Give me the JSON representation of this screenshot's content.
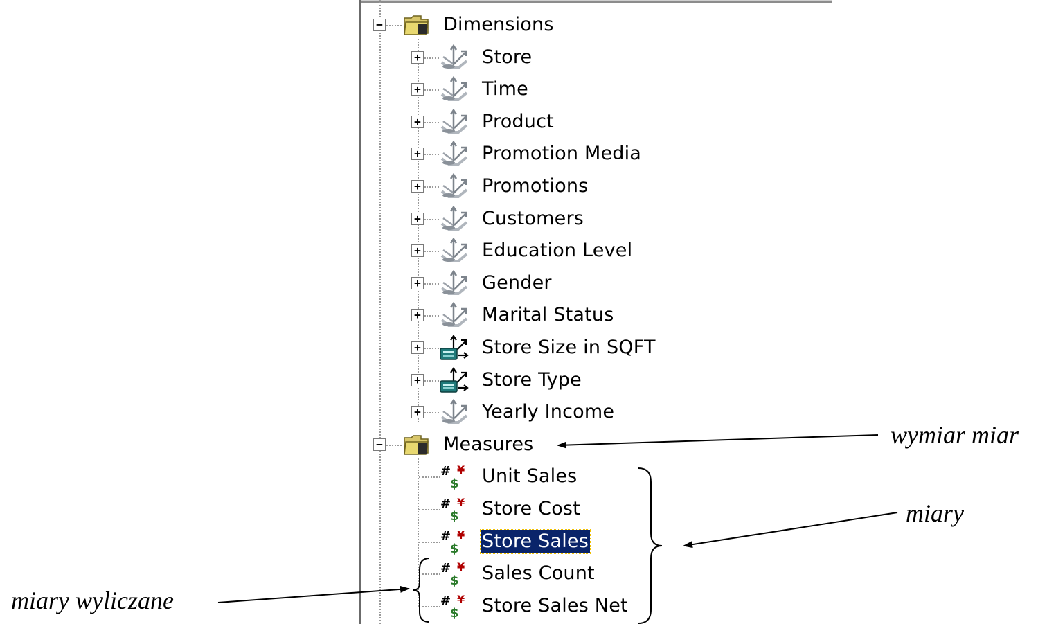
{
  "tree": {
    "dimensions_folder": {
      "label": "Dimensions",
      "expander": "−",
      "icon": "folder-open-icon",
      "items": [
        {
          "label": "Store",
          "expander": "+",
          "icon": "dimension-icon"
        },
        {
          "label": "Time",
          "expander": "+",
          "icon": "dimension-icon"
        },
        {
          "label": "Product",
          "expander": "+",
          "icon": "dimension-icon"
        },
        {
          "label": "Promotion Media",
          "expander": "+",
          "icon": "dimension-icon"
        },
        {
          "label": "Promotions",
          "expander": "+",
          "icon": "dimension-icon"
        },
        {
          "label": "Customers",
          "expander": "+",
          "icon": "dimension-icon"
        },
        {
          "label": "Education Level",
          "expander": "+",
          "icon": "dimension-icon"
        },
        {
          "label": "Gender",
          "expander": "+",
          "icon": "dimension-icon"
        },
        {
          "label": "Marital Status",
          "expander": "+",
          "icon": "dimension-icon"
        },
        {
          "label": "Store Size in SQFT",
          "expander": "+",
          "icon": "virtual-dimension-icon"
        },
        {
          "label": "Store Type",
          "expander": "+",
          "icon": "virtual-dimension-icon"
        },
        {
          "label": "Yearly Income",
          "expander": "+",
          "icon": "dimension-icon"
        }
      ]
    },
    "measures_folder": {
      "label": "Measures",
      "expander": "−",
      "icon": "folder-open-icon",
      "items": [
        {
          "label": "Unit Sales",
          "icon": "measure-icon",
          "selected": false
        },
        {
          "label": "Store Cost",
          "icon": "measure-icon",
          "selected": false
        },
        {
          "label": "Store Sales",
          "icon": "measure-icon",
          "selected": true
        },
        {
          "label": "Sales Count",
          "icon": "measure-icon",
          "selected": false
        },
        {
          "label": "Store Sales Net",
          "icon": "measure-icon",
          "selected": false
        }
      ]
    }
  },
  "annotations": {
    "measures_dimension": "wymiar miar",
    "measures": "miary",
    "calculated_measures": "miary wyliczane"
  },
  "colors": {
    "selection_bg": "#0a246a",
    "selection_fg": "#ffffff",
    "folder": "#e8d870",
    "dimension_icon": "#9aa0a8",
    "virtual_dimension_icon": "#1f7a7a",
    "measure_hash": "#000000",
    "measure_y": "#b00000",
    "measure_dollar": "#2a7a2a"
  }
}
